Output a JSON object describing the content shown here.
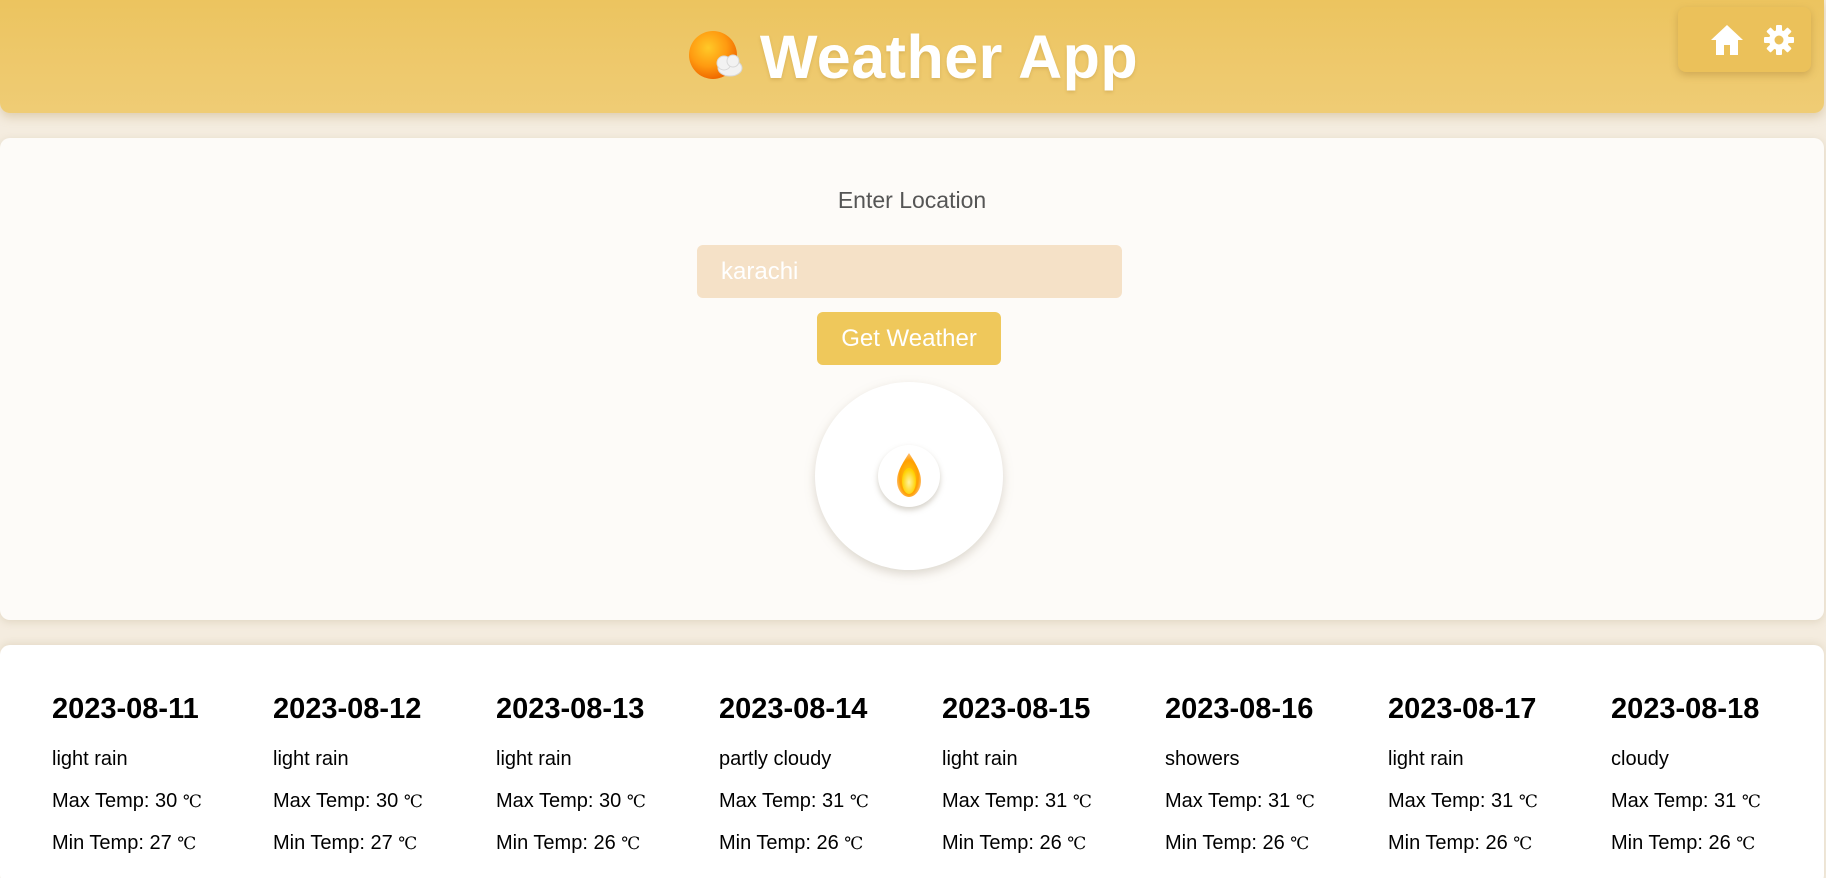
{
  "header": {
    "title": "Weather App",
    "logo_icon": "sun-behind-cloud-icon",
    "controls": [
      {
        "name": "home",
        "icon": "home-icon"
      },
      {
        "name": "settings",
        "icon": "gear-icon"
      }
    ]
  },
  "search": {
    "label": "Enter Location",
    "input_value": "karachi",
    "button_label": "Get Weather",
    "current_icon": "flame-icon"
  },
  "forecast": {
    "max_prefix": "Max Temp: ",
    "min_prefix": "Min Temp: ",
    "unit": "℃",
    "days": [
      {
        "date": "2023-08-11",
        "condition": "light rain",
        "max": "30",
        "min": "27"
      },
      {
        "date": "2023-08-12",
        "condition": "light rain",
        "max": "30",
        "min": "27"
      },
      {
        "date": "2023-08-13",
        "condition": "light rain",
        "max": "30",
        "min": "26"
      },
      {
        "date": "2023-08-14",
        "condition": "partly cloudy",
        "max": "31",
        "min": "26"
      },
      {
        "date": "2023-08-15",
        "condition": "light rain",
        "max": "31",
        "min": "26"
      },
      {
        "date": "2023-08-16",
        "condition": "showers",
        "max": "31",
        "min": "26"
      },
      {
        "date": "2023-08-17",
        "condition": "light rain",
        "max": "31",
        "min": "26"
      },
      {
        "date": "2023-08-18",
        "condition": "cloudy",
        "max": "31",
        "min": "26"
      }
    ]
  },
  "colors": {
    "header": "#ecc45f",
    "button": "#efc85b",
    "input_bg": "#f5e1c7",
    "page_bg": "#f4ecdf"
  }
}
